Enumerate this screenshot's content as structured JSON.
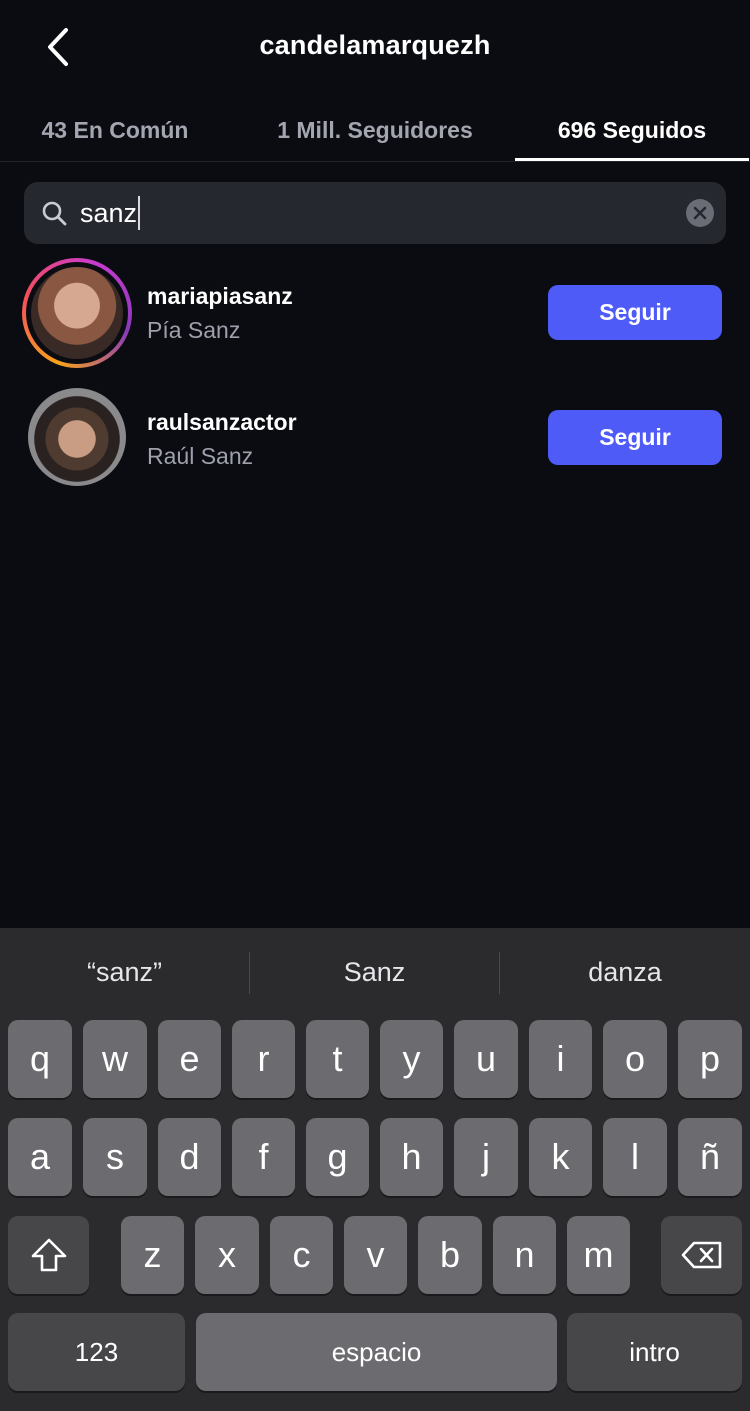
{
  "header": {
    "title": "candelamarquezh",
    "back_icon": "chevron-left-icon"
  },
  "tabs": [
    {
      "label": "43 En Común",
      "active": false
    },
    {
      "label": "1 Mill. Seguidores",
      "active": false
    },
    {
      "label": "696 Seguidos",
      "active": true
    }
  ],
  "search": {
    "value": "sanz",
    "icon": "search-icon",
    "clear_icon": "clear-icon"
  },
  "results": [
    {
      "username": "mariapiasanz",
      "full_name": "Pía Sanz",
      "button": "Seguir",
      "has_story": true
    },
    {
      "username": "raulsanzactor",
      "full_name": "Raúl Sanz",
      "button": "Seguir",
      "has_story": false
    }
  ],
  "keyboard": {
    "suggestions": [
      "“sanz”",
      "Sanz",
      "danza"
    ],
    "row1": [
      "q",
      "w",
      "e",
      "r",
      "t",
      "y",
      "u",
      "i",
      "o",
      "p"
    ],
    "row2": [
      "a",
      "s",
      "d",
      "f",
      "g",
      "h",
      "j",
      "k",
      "l",
      "ñ"
    ],
    "row3": [
      "z",
      "x",
      "c",
      "v",
      "b",
      "n",
      "m"
    ],
    "numbers_key": "123",
    "space_key": "espacio",
    "return_key": "intro",
    "shift_icon": "shift-icon",
    "delete_icon": "backspace-icon"
  },
  "colors": {
    "background": "#0b0c12",
    "accent": "#4e5bf7",
    "keyboard_bg": "#2b2b2e"
  }
}
